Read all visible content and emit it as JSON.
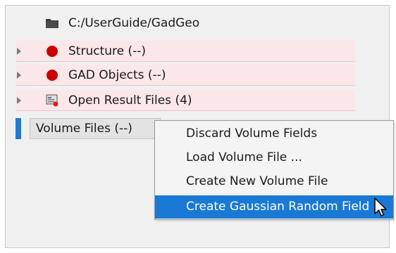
{
  "tree": {
    "root": {
      "label": "C:/UserGuide/GadGeo",
      "icon": "folder-icon"
    },
    "items": [
      {
        "label": "Structure (--)",
        "icon": "red-status-dot-icon",
        "status_color": "#cc0000"
      },
      {
        "label": "GAD Objects (--)",
        "icon": "red-status-dot-icon",
        "status_color": "#cc0000"
      },
      {
        "label": "Open Result Files (4)",
        "icon": "result-file-icon"
      },
      {
        "label": "Volume Files (--)",
        "selected": true
      }
    ]
  },
  "context_menu": {
    "items": [
      {
        "label": "Discard Volume Fields"
      },
      {
        "label": "Load Volume File ..."
      },
      {
        "label": "Create New Volume File"
      },
      {
        "label": "Create Gaussian Random Field",
        "highlighted": true
      }
    ],
    "highlight_color": "#1979d4"
  }
}
